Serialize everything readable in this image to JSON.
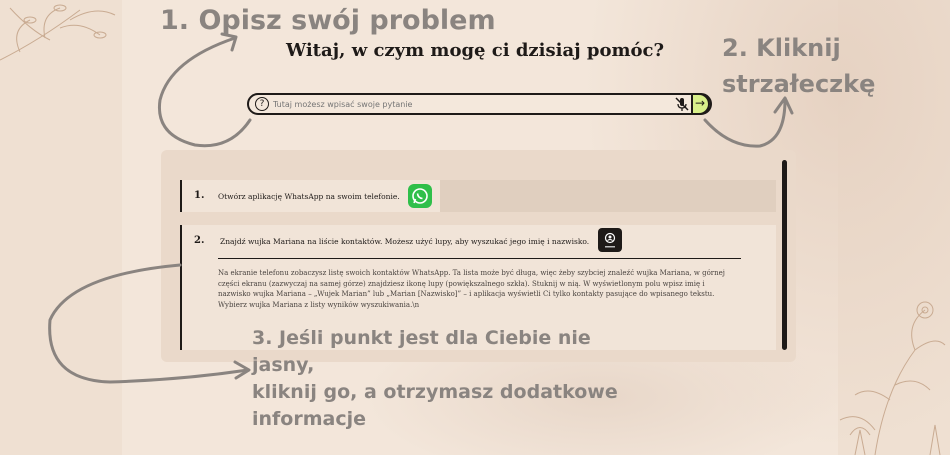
{
  "annotations": {
    "step1": "1. Opisz swój problem",
    "step2_line1": "2. Kliknij",
    "step2_line2": "strzałeczkę",
    "step3_line1": "3. Jeśli punkt jest dla Ciebie nie jasny,",
    "step3_line2": "kliknij go, a otrzymasz dodatkowe",
    "step3_line3": "informacje"
  },
  "header": {
    "title": "Witaj, w czym mogę ci dzisiaj pomóc?"
  },
  "search": {
    "placeholder": "Tutaj możesz wpisać swoje pytanie",
    "help_glyph": "?",
    "send_glyph": "→"
  },
  "steps": [
    {
      "number": "1.",
      "text": "Otwórz aplikację WhatsApp na swoim telefonie."
    },
    {
      "number": "2.",
      "text": "Znajdź wujka Mariana na liście kontaktów. Możesz użyć lupy, aby wyszukać jego imię i nazwisko.",
      "description": "Na ekranie telefonu zobaczysz listę swoich kontaktów WhatsApp. Ta lista może być długa, więc żeby szybciej znaleźć wujka Mariana, w górnej części ekranu (zazwyczaj na samej górze) znajdziesz ikonę lupy (powiększalnego szkła). Stuknij w nią. W wyświetlonym polu wpisz imię i nazwisko wujka Mariana – „Wujek Marian” lub „Marian [Nazwisko]” – i aplikacja wyświetli Ci tylko kontakty pasujące do wpisanego tekstu. Wybierz wujka Mariana z listy wyników wyszukiwania.\\n"
    }
  ],
  "colors": {
    "send_button": "#d9f08a",
    "whatsapp": "#2fbf4a",
    "annotation": "#8a8480"
  },
  "icons": [
    "help-icon",
    "mic-off-icon",
    "arrow-right-icon",
    "whatsapp-icon",
    "contact-icon"
  ]
}
